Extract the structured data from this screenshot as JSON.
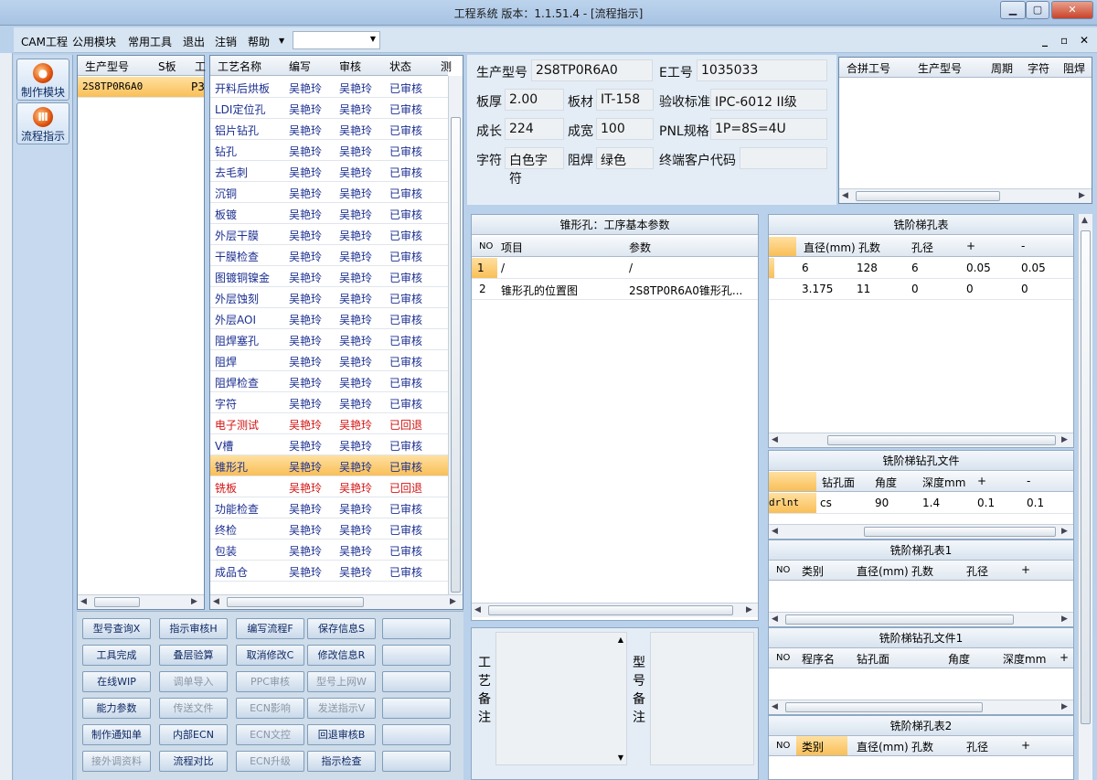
{
  "window": {
    "title": "工程系统   版本：1.1.51.4 - [流程指示]"
  },
  "menu": [
    "CAM工程",
    "公用模块",
    "常用工具",
    "退出",
    "注销",
    "帮助"
  ],
  "nav": [
    {
      "label": "制作模块"
    },
    {
      "label": "流程指示"
    }
  ],
  "model_grid": {
    "headers": [
      "生产型号",
      "S板",
      "工"
    ],
    "rows": [
      [
        "2S8TP0R6A0",
        "P3"
      ]
    ]
  },
  "process_grid": {
    "headers": [
      "工艺名称",
      "编写",
      "审核",
      "状态",
      "测"
    ],
    "rows": [
      {
        "name": "开料后烘板",
        "writer": "吴艳玲",
        "reviewer": "吴艳玲",
        "status": "已审核",
        "state": "ok"
      },
      {
        "name": "LDI定位孔",
        "writer": "吴艳玲",
        "reviewer": "吴艳玲",
        "status": "已审核",
        "state": "ok"
      },
      {
        "name": "铝片钻孔",
        "writer": "吴艳玲",
        "reviewer": "吴艳玲",
        "status": "已审核",
        "state": "ok"
      },
      {
        "name": "钻孔",
        "writer": "吴艳玲",
        "reviewer": "吴艳玲",
        "status": "已审核",
        "state": "ok"
      },
      {
        "name": "去毛刺",
        "writer": "吴艳玲",
        "reviewer": "吴艳玲",
        "status": "已审核",
        "state": "ok"
      },
      {
        "name": "沉铜",
        "writer": "吴艳玲",
        "reviewer": "吴艳玲",
        "status": "已审核",
        "state": "ok"
      },
      {
        "name": "板镀",
        "writer": "吴艳玲",
        "reviewer": "吴艳玲",
        "status": "已审核",
        "state": "ok"
      },
      {
        "name": "外层干膜",
        "writer": "吴艳玲",
        "reviewer": "吴艳玲",
        "status": "已审核",
        "state": "ok"
      },
      {
        "name": "干膜检查",
        "writer": "吴艳玲",
        "reviewer": "吴艳玲",
        "status": "已审核",
        "state": "ok"
      },
      {
        "name": "图镀铜镍金",
        "writer": "吴艳玲",
        "reviewer": "吴艳玲",
        "status": "已审核",
        "state": "ok"
      },
      {
        "name": "外层蚀刻",
        "writer": "吴艳玲",
        "reviewer": "吴艳玲",
        "status": "已审核",
        "state": "ok"
      },
      {
        "name": "外层AOI",
        "writer": "吴艳玲",
        "reviewer": "吴艳玲",
        "status": "已审核",
        "state": "ok"
      },
      {
        "name": "阻焊塞孔",
        "writer": "吴艳玲",
        "reviewer": "吴艳玲",
        "status": "已审核",
        "state": "ok"
      },
      {
        "name": "阻焊",
        "writer": "吴艳玲",
        "reviewer": "吴艳玲",
        "status": "已审核",
        "state": "ok"
      },
      {
        "name": "阻焊检查",
        "writer": "吴艳玲",
        "reviewer": "吴艳玲",
        "status": "已审核",
        "state": "ok"
      },
      {
        "name": "字符",
        "writer": "吴艳玲",
        "reviewer": "吴艳玲",
        "status": "已审核",
        "state": "ok"
      },
      {
        "name": "电子测试",
        "writer": "吴艳玲",
        "reviewer": "吴艳玲",
        "status": "已回退",
        "state": "back"
      },
      {
        "name": "V槽",
        "writer": "吴艳玲",
        "reviewer": "吴艳玲",
        "status": "已审核",
        "state": "ok"
      },
      {
        "name": "锥形孔",
        "writer": "吴艳玲",
        "reviewer": "吴艳玲",
        "status": "已审核",
        "state": "sel"
      },
      {
        "name": "铣板",
        "writer": "吴艳玲",
        "reviewer": "吴艳玲",
        "status": "已回退",
        "state": "back"
      },
      {
        "name": "功能检查",
        "writer": "吴艳玲",
        "reviewer": "吴艳玲",
        "status": "已审核",
        "state": "ok"
      },
      {
        "name": "终检",
        "writer": "吴艳玲",
        "reviewer": "吴艳玲",
        "status": "已审核",
        "state": "ok"
      },
      {
        "name": "包装",
        "writer": "吴艳玲",
        "reviewer": "吴艳玲",
        "status": "已审核",
        "state": "ok"
      },
      {
        "name": "成品仓",
        "writer": "吴艳玲",
        "reviewer": "吴艳玲",
        "status": "已审核",
        "state": "ok"
      }
    ]
  },
  "buttons": [
    [
      {
        "t": "型号查询X",
        "d": false
      },
      {
        "t": "指示审核H",
        "d": false
      },
      {
        "t": "编写流程F",
        "d": false
      },
      {
        "t": "保存信息S",
        "d": false
      },
      {
        "t": "",
        "d": false
      }
    ],
    [
      {
        "t": "工具完成",
        "d": false
      },
      {
        "t": "叠层验算",
        "d": false
      },
      {
        "t": "取消修改C",
        "d": false
      },
      {
        "t": "修改信息R",
        "d": false
      },
      {
        "t": "",
        "d": false
      }
    ],
    [
      {
        "t": "在线WIP",
        "d": false
      },
      {
        "t": "调单导入",
        "d": true
      },
      {
        "t": "PPC审核",
        "d": true
      },
      {
        "t": "型号上网W",
        "d": true
      },
      {
        "t": "",
        "d": false
      }
    ],
    [
      {
        "t": "能力参数",
        "d": false
      },
      {
        "t": "传送文件",
        "d": true
      },
      {
        "t": "ECN影响",
        "d": true
      },
      {
        "t": "发送指示V",
        "d": true
      },
      {
        "t": "",
        "d": false
      }
    ],
    [
      {
        "t": "制作通知单",
        "d": false
      },
      {
        "t": "内部ECN",
        "d": false
      },
      {
        "t": "ECN文控",
        "d": true
      },
      {
        "t": "回退审核B",
        "d": false
      },
      {
        "t": "",
        "d": false
      }
    ],
    [
      {
        "t": "接外调资料",
        "d": true
      },
      {
        "t": "流程对比",
        "d": false
      },
      {
        "t": "ECN升级",
        "d": true
      },
      {
        "t": "指示检查",
        "d": false
      },
      {
        "t": "",
        "d": false
      }
    ]
  ],
  "info": {
    "model_label": "生产型号",
    "model": "2S8TP0R6A0",
    "e_label": "E工号",
    "e_no": "1035033",
    "thick_label": "板厚",
    "thick": "2.00",
    "mat_label": "板材",
    "mat": "IT-158",
    "std_label": "验收标准",
    "std": "IPC-6012 II级",
    "len_label": "成长",
    "len": "224",
    "wid_label": "成宽",
    "wid": "100",
    "pnl_label": "PNL规格",
    "pnl": "1P=8S=4U",
    "char_label": "字符",
    "char": "白色字符",
    "mask_label": "阻焊",
    "mask": "绿色",
    "cust_label": "终端客户代码",
    "cust": ""
  },
  "combine_grid": {
    "headers": [
      "合拼工号",
      "生产型号",
      "周期",
      "字符",
      "阻焊"
    ]
  },
  "param_panel": {
    "title": "锥形孔：工序基本参数",
    "headers": [
      "NO",
      "项目",
      "参数"
    ],
    "rows": [
      [
        "1",
        "/",
        "/"
      ],
      [
        "2",
        "锥形孔的位置图",
        "2S8TP0R6A0锥形孔..."
      ]
    ]
  },
  "remarks": {
    "process": "工艺备注",
    "model": "型号备注"
  },
  "step_hole": {
    "title": "铣阶梯孔表",
    "headers": [
      "直径(mm)",
      "孔数",
      "孔径",
      "+",
      "-"
    ],
    "rows": [
      [
        "6",
        "128",
        "6",
        "0.05",
        "0.05"
      ],
      [
        "3.175",
        "11",
        "0",
        "0",
        "0"
      ]
    ]
  },
  "step_drill": {
    "title": "铣阶梯钻孔文件",
    "headers": [
      "钻孔面",
      "角度",
      "深度mm",
      "+",
      "-"
    ],
    "rows": [
      [
        "drlnt",
        "cs",
        "90",
        "1.4",
        "0.1",
        "0.1"
      ]
    ]
  },
  "step_hole1": {
    "title": "铣阶梯孔表1",
    "headers": [
      "NO",
      "类别",
      "直径(mm)",
      "孔数",
      "孔径",
      "+"
    ]
  },
  "step_drill1": {
    "title": "铣阶梯钻孔文件1",
    "headers": [
      "NO",
      "程序名",
      "钻孔面",
      "角度",
      "深度mm",
      "+"
    ]
  },
  "step_hole2": {
    "title": "铣阶梯孔表2",
    "headers": [
      "NO",
      "类别",
      "直径(mm)",
      "孔数",
      "孔径",
      "+"
    ]
  }
}
